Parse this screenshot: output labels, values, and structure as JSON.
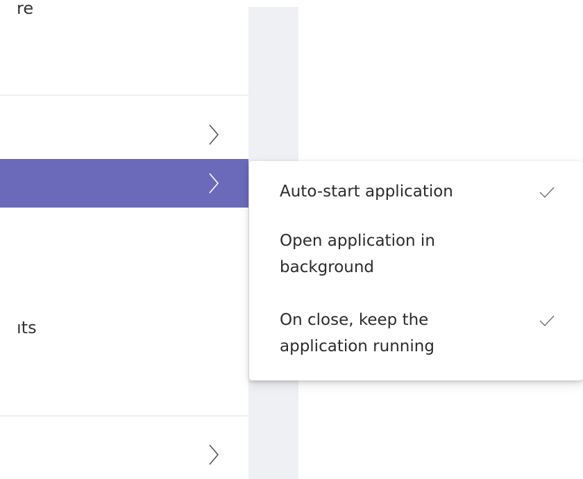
{
  "menu": {
    "partial_top_text": "re",
    "partial_mid_text": "ıts",
    "rows": [
      {
        "has_submenu": true,
        "selected": false
      },
      {
        "has_submenu": true,
        "selected": true
      },
      {
        "has_submenu": true,
        "selected": false
      }
    ],
    "selected_color": "#6b69ba"
  },
  "flyout": {
    "items": [
      {
        "label": "Auto-start application",
        "checked": true
      },
      {
        "label": "Open application in background",
        "checked": false
      },
      {
        "label": "On close, keep the application running",
        "checked": true
      }
    ]
  },
  "icons": {
    "chevron": "chevron-right-icon",
    "check": "checkmark-icon"
  }
}
